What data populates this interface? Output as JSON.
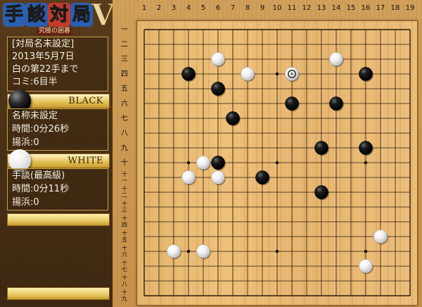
{
  "logo": {
    "chars": [
      "手",
      "談",
      "対",
      "局"
    ],
    "char_colors": [
      "#2a5fb0",
      "#2a5fb0",
      "#c23a2a",
      "#2a5fb0"
    ],
    "version": "V",
    "subtitle": "究極の囲碁"
  },
  "game_info": {
    "title": "[対局名未設定]",
    "date": "2013年5月7日",
    "move": "白の第22手まで",
    "komi": "コミ:6目半"
  },
  "black_player": {
    "label": "BLACK",
    "name": "名称未設定",
    "time": "時間:0分26秒",
    "captures": "揚浜:0"
  },
  "white_player": {
    "label": "WHITE",
    "name": "手談(最高級)",
    "time": "時間:0分11秒",
    "captures": "揚浜:0"
  },
  "board": {
    "size": 19,
    "col_labels": [
      "1",
      "2",
      "3",
      "4",
      "5",
      "6",
      "7",
      "8",
      "9",
      "10",
      "11",
      "12",
      "13",
      "14",
      "15",
      "16",
      "17",
      "18",
      "19"
    ],
    "row_labels": [
      "一",
      "二",
      "三",
      "四",
      "五",
      "六",
      "七",
      "八",
      "九",
      "十",
      "十一",
      "十二",
      "十三",
      "十四",
      "十五",
      "十六",
      "十七",
      "十八",
      "十九"
    ],
    "stones": [
      {
        "color": "white",
        "col": 6,
        "row": 3
      },
      {
        "color": "white",
        "col": 14,
        "row": 3
      },
      {
        "color": "black",
        "col": 4,
        "row": 4
      },
      {
        "color": "white",
        "col": 8,
        "row": 4
      },
      {
        "color": "black",
        "col": 16,
        "row": 4
      },
      {
        "color": "black",
        "col": 6,
        "row": 5
      },
      {
        "color": "black",
        "col": 11,
        "row": 6
      },
      {
        "color": "black",
        "col": 14,
        "row": 6
      },
      {
        "color": "black",
        "col": 7,
        "row": 7
      },
      {
        "color": "black",
        "col": 13,
        "row": 9
      },
      {
        "color": "black",
        "col": 16,
        "row": 9
      },
      {
        "color": "white",
        "col": 5,
        "row": 10
      },
      {
        "color": "black",
        "col": 6,
        "row": 10
      },
      {
        "color": "white",
        "col": 4,
        "row": 11
      },
      {
        "color": "white",
        "col": 6,
        "row": 11
      },
      {
        "color": "black",
        "col": 9,
        "row": 11
      },
      {
        "color": "black",
        "col": 13,
        "row": 12
      },
      {
        "color": "white",
        "col": 17,
        "row": 15
      },
      {
        "color": "white",
        "col": 3,
        "row": 16
      },
      {
        "color": "white",
        "col": 5,
        "row": 16
      },
      {
        "color": "white",
        "col": 16,
        "row": 17
      }
    ],
    "last_move": {
      "color": "white",
      "col": 11,
      "row": 4
    },
    "star_points": [
      [
        4,
        4
      ],
      [
        10,
        4
      ],
      [
        16,
        4
      ],
      [
        4,
        10
      ],
      [
        10,
        10
      ],
      [
        16,
        10
      ],
      [
        4,
        16
      ],
      [
        10,
        16
      ],
      [
        16,
        16
      ]
    ]
  }
}
